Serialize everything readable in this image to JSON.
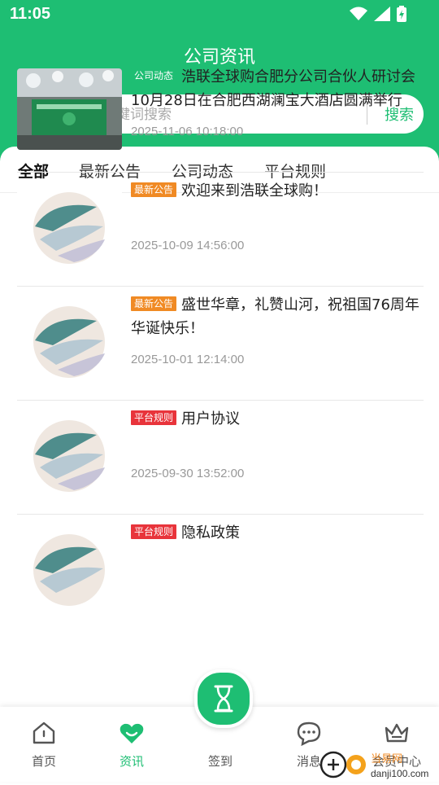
{
  "status_bar": {
    "time": "11:05"
  },
  "header": {
    "title": "公司资讯"
  },
  "search": {
    "placeholder": "请输入关键词搜索",
    "button_label": "搜索"
  },
  "tabs": [
    {
      "label": "全部",
      "active": true
    },
    {
      "label": "最新公告",
      "active": false
    },
    {
      "label": "公司动态",
      "active": false
    },
    {
      "label": "平台规则",
      "active": false
    }
  ],
  "colors": {
    "brand": "#1ebe73",
    "tag_dynamic": "#1ebe73",
    "tag_notice": "#f08a24",
    "tag_rule": "#e8343b"
  },
  "articles": [
    {
      "tag": "公司动态",
      "title": "浩联全球购合肥分公司合伙人研讨会10月28日在合肥西湖澜宝大酒店圆满举行",
      "date": "2025-11-06 10:18:00",
      "image": "event-photo"
    },
    {
      "tag": "最新公告",
      "title": "欢迎来到浩联全球购！",
      "date": "2025-10-09 14:56:00",
      "image": "logo-sphere"
    },
    {
      "tag": "最新公告",
      "title": "盛世华章，礼赞山河，祝祖国76周年华诞快乐！",
      "date": "2025-10-01 12:14:00",
      "image": "logo-sphere"
    },
    {
      "tag": "平台规则",
      "title": "用户协议",
      "date": "2025-09-30 13:52:00",
      "image": "logo-sphere"
    },
    {
      "tag": "平台规则",
      "title": "隐私政策",
      "date": "",
      "image": "logo-sphere"
    }
  ],
  "bottom_nav": [
    {
      "label": "首页",
      "icon": "home-icon",
      "active": false
    },
    {
      "label": "资讯",
      "icon": "heart-icon",
      "active": true
    },
    {
      "label": "签到",
      "icon": "hourglass-icon",
      "active": false
    },
    {
      "label": "消息",
      "icon": "chat-icon",
      "active": false
    },
    {
      "label": "会员中心",
      "icon": "crown-icon",
      "active": false
    }
  ],
  "watermark": {
    "text": "当易网",
    "url_text": "danji100.com"
  }
}
